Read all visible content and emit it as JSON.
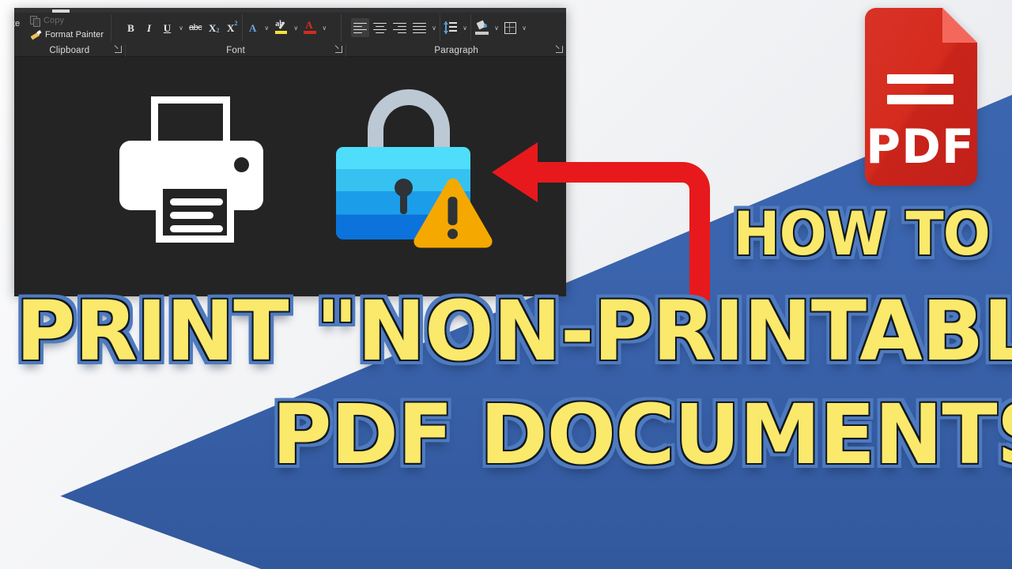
{
  "thumbnail": {
    "background": {
      "blue": "#3A63AC",
      "white": "#F2F3F5"
    },
    "title_line_1": "PRINT \"NON-PRINTABLE\"",
    "title_line_2": "PDF DOCUMENTS",
    "eyebrow": "HOW TO",
    "title_color": "#FAE96B",
    "title_outline_color": "#111822",
    "title_glow_color": "#4E7ABF"
  },
  "pdf_badge": {
    "label": "PDF",
    "body_color": "#D52B1E",
    "fold_color": "#F4685C",
    "text_color": "#FFFFFF"
  },
  "arrow": {
    "name": "red-elbow-arrow",
    "color": "#E8191C",
    "direction": "left"
  },
  "word_screenshot": {
    "background": "#242424",
    "ribbon_background": "#2B2B2B",
    "clipboard": {
      "group_label": "Clipboard",
      "paste_label": "te",
      "items": [
        {
          "label": "Copy",
          "icon": "copy-icon",
          "enabled": false
        },
        {
          "label": "Format Painter",
          "icon": "format-painter-icon",
          "enabled": true
        }
      ],
      "dialog_launcher": "dialog-launcher"
    },
    "font": {
      "group_label": "Font",
      "buttons": [
        {
          "name": "bold-button",
          "glyph": "B"
        },
        {
          "name": "italic-button",
          "glyph": "I"
        },
        {
          "name": "underline-button",
          "glyph": "U"
        },
        {
          "name": "underline-dropdown",
          "glyph": "∨"
        },
        {
          "name": "strikethrough-button",
          "glyph": "abc"
        },
        {
          "name": "subscript-button",
          "glyph": "X"
        },
        {
          "name": "superscript-button",
          "glyph": "X"
        },
        {
          "name": "text-effects-button",
          "glyph": "A"
        },
        {
          "name": "text-effects-dropdown",
          "glyph": "∨"
        },
        {
          "name": "text-highlight-button",
          "glyph": "ab"
        },
        {
          "name": "text-highlight-dropdown",
          "glyph": "∨"
        },
        {
          "name": "font-color-button",
          "glyph": "A"
        },
        {
          "name": "font-color-dropdown",
          "glyph": "∨"
        }
      ],
      "highlight_color": "#F2E23A",
      "font_color": "#D42A20"
    },
    "paragraph": {
      "group_label": "Paragraph",
      "buttons": [
        {
          "name": "align-left-button",
          "selected": true
        },
        {
          "name": "align-center-button",
          "selected": false
        },
        {
          "name": "align-right-button",
          "selected": false
        },
        {
          "name": "align-justify-button",
          "selected": false
        },
        {
          "name": "align-justify-dropdown",
          "glyph": "∨"
        },
        {
          "name": "line-spacing-button",
          "selected": false
        },
        {
          "name": "line-spacing-dropdown",
          "glyph": "∨"
        },
        {
          "name": "shading-button",
          "selected": false
        },
        {
          "name": "shading-dropdown",
          "glyph": "∨"
        },
        {
          "name": "borders-button",
          "selected": false
        },
        {
          "name": "borders-dropdown",
          "glyph": "∨"
        }
      ]
    },
    "canvas_icons": {
      "printer": {
        "name": "printer-icon",
        "color": "#FFFFFF"
      },
      "lock": {
        "name": "locked-document-icon",
        "shackle_color": "#BCC8D4",
        "body_gradient": [
          "#4FDDFC",
          "#35C2F1",
          "#1C9DE9",
          "#0B73DB"
        ],
        "keyhole_color": "#2E3338",
        "warning_color": "#F5A800"
      }
    }
  }
}
